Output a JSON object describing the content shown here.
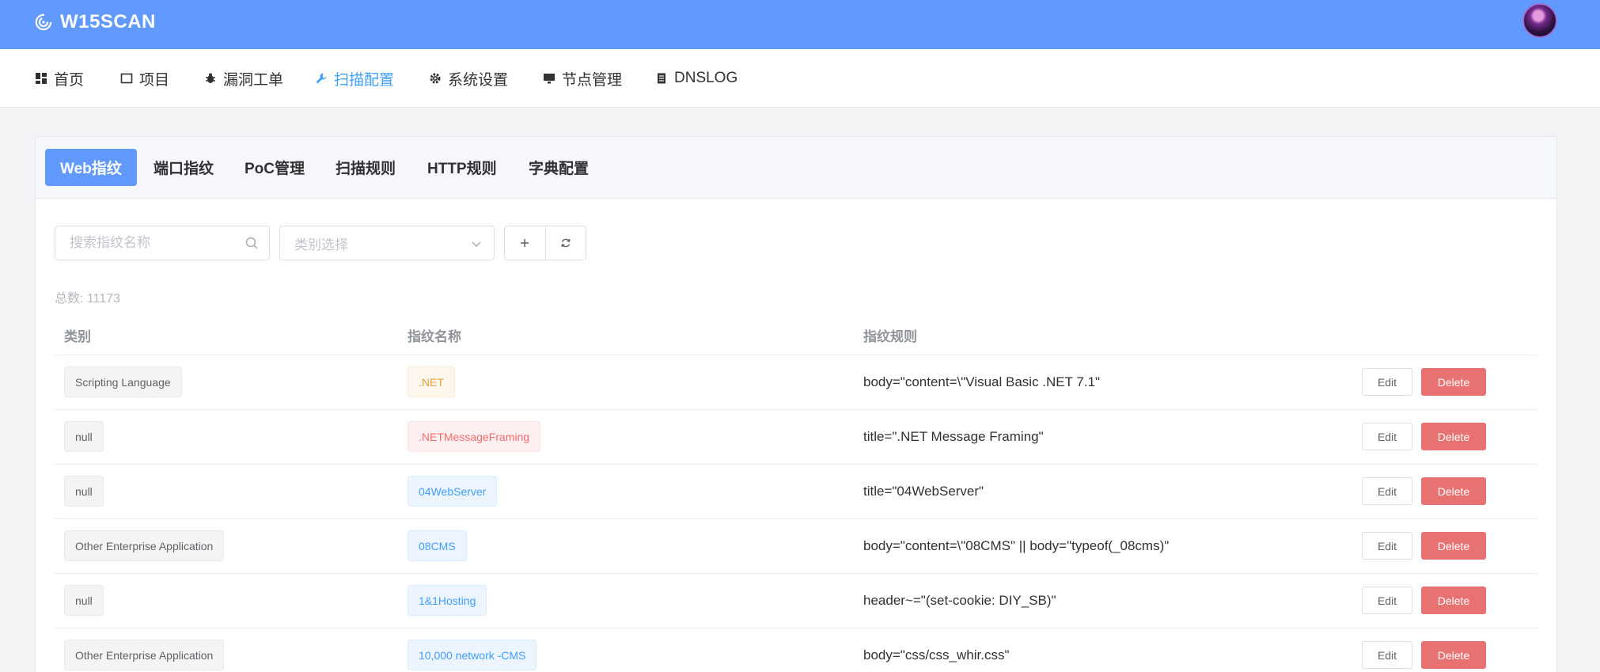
{
  "brand": {
    "name": "W15SCAN",
    "icon": "radar-icon"
  },
  "nav": [
    {
      "label": "首页",
      "icon": "dashboard-icon"
    },
    {
      "label": "项目",
      "icon": "folder-icon"
    },
    {
      "label": "漏洞工单",
      "icon": "bug-icon"
    },
    {
      "label": "扫描配置",
      "icon": "wrench-icon",
      "active": true
    },
    {
      "label": "系统设置",
      "icon": "gear-icon"
    },
    {
      "label": "节点管理",
      "icon": "monitor-icon"
    },
    {
      "label": "DNSLOG",
      "icon": "document-icon"
    }
  ],
  "tabs": [
    "Web指纹",
    "端口指纹",
    "PoC管理",
    "扫描规则",
    "HTTP规则",
    "字典配置"
  ],
  "search": {
    "placeholder": "搜索指纹名称"
  },
  "category_select": {
    "placeholder": "类别选择"
  },
  "total_label": "总数: 11173",
  "table": {
    "headers": {
      "category": "类别",
      "name": "指纹名称",
      "rule": "指纹规则"
    },
    "rows": [
      {
        "category": "Scripting Language",
        "name": ".NET",
        "tag_type": "warning",
        "rule": "body=\"content=\\\"Visual Basic .NET 7.1\""
      },
      {
        "category": "null",
        "name": ".NETMessageFraming",
        "tag_type": "danger",
        "rule": "title=\".NET Message Framing\""
      },
      {
        "category": "null",
        "name": "04WebServer",
        "tag_type": "primary",
        "rule": "title=\"04WebServer\""
      },
      {
        "category": "Other Enterprise Application",
        "name": "08CMS",
        "tag_type": "primary",
        "rule": "body=\"content=\\\"08CMS\" || body=\"typeof(_08cms)\""
      },
      {
        "category": "null",
        "name": "1&1Hosting",
        "tag_type": "primary",
        "rule": "header~=\"(set-cookie: DIY_SB)\""
      },
      {
        "category": "Other Enterprise Application",
        "name": "10,000 network -CMS",
        "tag_type": "primary",
        "rule": "body=\"css/css_whir.css\""
      }
    ],
    "edit_label": "Edit",
    "delete_label": "Delete"
  },
  "colors": {
    "header": "#6199ff",
    "active_tab": "#6199ff",
    "active_nav": "#409eff",
    "delete": "#e87272"
  }
}
